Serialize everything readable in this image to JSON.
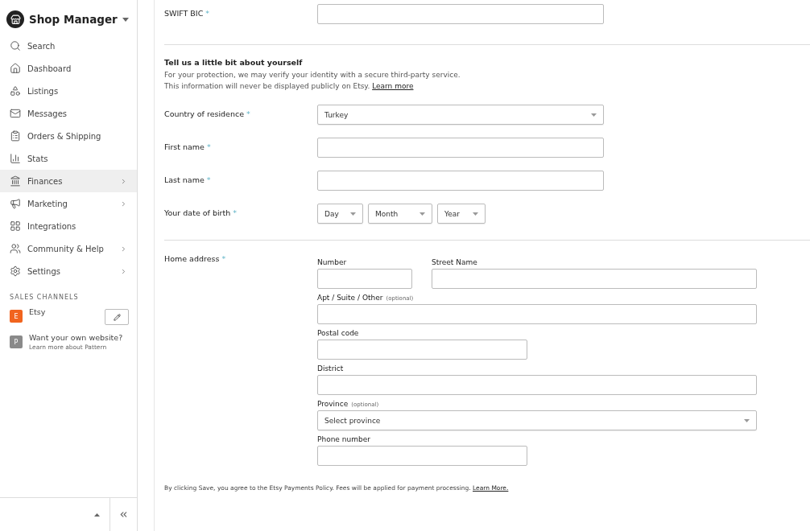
{
  "sidebar": {
    "title": "Shop Manager",
    "items": [
      {
        "label": "Search",
        "selected": false,
        "has_submenu": false
      },
      {
        "label": "Dashboard",
        "selected": false,
        "has_submenu": false
      },
      {
        "label": "Listings",
        "selected": false,
        "has_submenu": false
      },
      {
        "label": "Messages",
        "selected": false,
        "has_submenu": false
      },
      {
        "label": "Orders & Shipping",
        "selected": false,
        "has_submenu": false
      },
      {
        "label": "Stats",
        "selected": false,
        "has_submenu": false
      },
      {
        "label": "Finances",
        "selected": true,
        "has_submenu": true
      },
      {
        "label": "Marketing",
        "selected": false,
        "has_submenu": true
      },
      {
        "label": "Integrations",
        "selected": false,
        "has_submenu": false
      },
      {
        "label": "Community & Help",
        "selected": false,
        "has_submenu": true
      },
      {
        "label": "Settings",
        "selected": false,
        "has_submenu": true
      }
    ],
    "sales_channels": {
      "heading": "SALES CHANNELS",
      "channels": [
        {
          "badge": "E",
          "name": "Etsy",
          "color": "#f1641e",
          "editable": true
        },
        {
          "badge": "P",
          "name": "Want your own website?",
          "subtitle": "Learn more about Pattern",
          "color": "#8a8a8a",
          "editable": false
        }
      ]
    }
  },
  "form": {
    "swift": {
      "label": "SWIFT BIC",
      "marker": "*"
    },
    "about": {
      "title": "Tell us a little bit about yourself",
      "text": "For your protection, we may verify your identity with a secure third-party service.",
      "text2": "This information will never be displayed publicly on Etsy.",
      "link": "Learn more"
    },
    "personal": [
      {
        "kind": "select",
        "label": "Country of residence",
        "marker": "*",
        "value": "Turkey"
      },
      {
        "kind": "text",
        "label": "First name",
        "marker": "*"
      },
      {
        "kind": "text",
        "label": "Last name",
        "marker": "*"
      },
      {
        "kind": "date",
        "label": "Your date of birth",
        "marker": "*",
        "parts": [
          "Day",
          "Month",
          "Year"
        ]
      }
    ],
    "address": {
      "label": "Home address",
      "marker": "*",
      "rows": [
        [
          {
            "kind": "text",
            "label": "Number"
          },
          {
            "kind": "text",
            "label": "Street Name"
          }
        ],
        [
          {
            "kind": "text",
            "label": "Apt / Suite / Other",
            "note": "(optional)"
          }
        ],
        [
          {
            "kind": "text",
            "label": "Postal code"
          }
        ],
        [
          {
            "kind": "text",
            "label": "District"
          }
        ],
        [
          {
            "kind": "select",
            "label": "Province",
            "note": "(optional)",
            "value": "Select province"
          }
        ],
        [
          {
            "kind": "text",
            "label": "Phone number"
          }
        ]
      ]
    },
    "footer": {
      "text": "By clicking Save, you agree to the Etsy Payments Policy. Fees will be applied for payment processing.",
      "link": "Learn More."
    }
  }
}
